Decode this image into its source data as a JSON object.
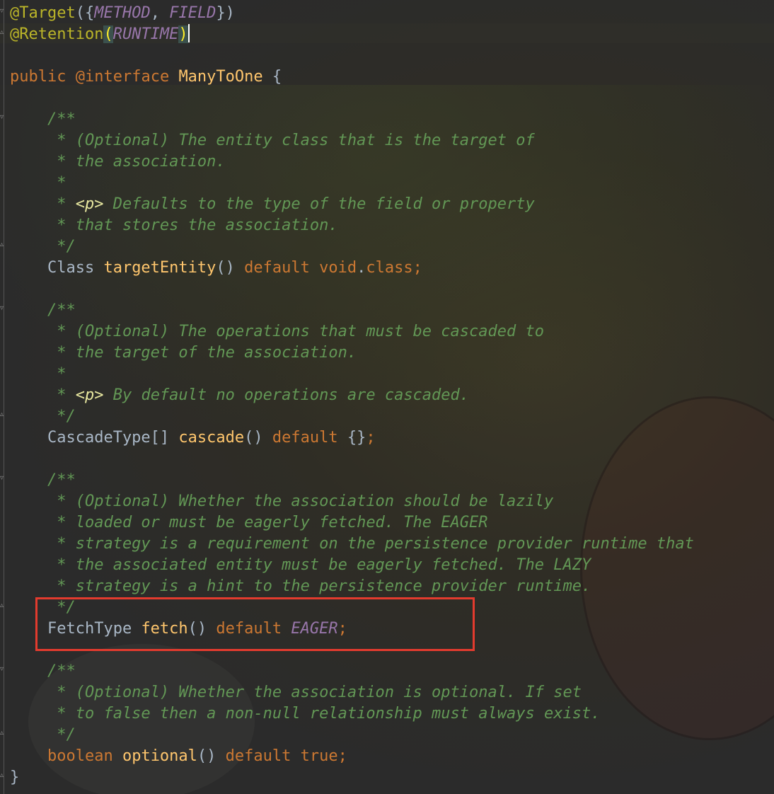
{
  "code_lines": [
    {
      "tokens": [
        {
          "t": "@Target",
          "c": "ann"
        },
        {
          "t": "({"
        },
        {
          "t": "METHOD",
          "c": "const"
        },
        {
          "t": ", "
        },
        {
          "t": "FIELD",
          "c": "const"
        },
        {
          "t": "})"
        }
      ]
    },
    {
      "tokens": [
        {
          "t": "@Retention",
          "c": "ann"
        },
        {
          "t": "(",
          "c": "brace-match"
        },
        {
          "t": "RUNTIME",
          "c": "const"
        },
        {
          "t": ")",
          "c": "brace-match"
        },
        {
          "t": "",
          "c": "caret"
        }
      ]
    },
    {
      "tokens": []
    },
    {
      "tokens": [
        {
          "t": "public",
          "c": "kw"
        },
        {
          "t": " "
        },
        {
          "t": "@interface",
          "c": "kw"
        },
        {
          "t": " "
        },
        {
          "t": "ManyToOne",
          "c": "fn"
        },
        {
          "t": " {"
        }
      ]
    },
    {
      "tokens": []
    },
    {
      "tokens": [
        {
          "t": "    /**",
          "c": "cmt"
        }
      ]
    },
    {
      "tokens": [
        {
          "t": "     * (Optional) The entity class that is the target of",
          "c": "cmt"
        }
      ]
    },
    {
      "tokens": [
        {
          "t": "     * the association.",
          "c": "cmt"
        }
      ]
    },
    {
      "tokens": [
        {
          "t": "     *",
          "c": "cmt"
        }
      ]
    },
    {
      "tokens": [
        {
          "t": "     * ",
          "c": "cmt"
        },
        {
          "t": "<p>",
          "c": "tag"
        },
        {
          "t": " Defaults to the type of the field or property",
          "c": "cmt"
        }
      ]
    },
    {
      "tokens": [
        {
          "t": "     * that stores the association.",
          "c": "cmt"
        }
      ]
    },
    {
      "tokens": [
        {
          "t": "     */",
          "c": "cmt"
        }
      ]
    },
    {
      "tokens": [
        {
          "t": "    Class "
        },
        {
          "t": "targetEntity",
          "c": "fn"
        },
        {
          "t": "() "
        },
        {
          "t": "default",
          "c": "kw"
        },
        {
          "t": " "
        },
        {
          "t": "void",
          "c": "kw"
        },
        {
          "t": "."
        },
        {
          "t": "class",
          "c": "kw"
        },
        {
          "t": ";",
          "c": "kw"
        }
      ]
    },
    {
      "tokens": []
    },
    {
      "tokens": [
        {
          "t": "    /**",
          "c": "cmt"
        }
      ]
    },
    {
      "tokens": [
        {
          "t": "     * (Optional) The operations that must be cascaded to",
          "c": "cmt"
        }
      ]
    },
    {
      "tokens": [
        {
          "t": "     * the target of the association.",
          "c": "cmt"
        }
      ]
    },
    {
      "tokens": [
        {
          "t": "     *",
          "c": "cmt"
        }
      ]
    },
    {
      "tokens": [
        {
          "t": "     * ",
          "c": "cmt"
        },
        {
          "t": "<p>",
          "c": "tag"
        },
        {
          "t": " By default no operations are cascaded.",
          "c": "cmt"
        }
      ]
    },
    {
      "tokens": [
        {
          "t": "     */",
          "c": "cmt"
        }
      ]
    },
    {
      "tokens": [
        {
          "t": "    CascadeType[] "
        },
        {
          "t": "cascade",
          "c": "fn"
        },
        {
          "t": "() "
        },
        {
          "t": "default",
          "c": "kw"
        },
        {
          "t": " {}"
        },
        {
          "t": ";",
          "c": "kw"
        }
      ]
    },
    {
      "tokens": []
    },
    {
      "tokens": [
        {
          "t": "    /**",
          "c": "cmt"
        }
      ]
    },
    {
      "tokens": [
        {
          "t": "     * (Optional) Whether the association should be lazily",
          "c": "cmt"
        }
      ]
    },
    {
      "tokens": [
        {
          "t": "     * loaded or must be eagerly fetched. The EAGER",
          "c": "cmt"
        }
      ]
    },
    {
      "tokens": [
        {
          "t": "     * strategy is a requirement on the persistence provider runtime that",
          "c": "cmt"
        }
      ]
    },
    {
      "tokens": [
        {
          "t": "     * the associated entity must be eagerly fetched. The LAZY",
          "c": "cmt"
        }
      ]
    },
    {
      "tokens": [
        {
          "t": "     * strategy is a hint to the persistence provider runtime.",
          "c": "cmt"
        }
      ]
    },
    {
      "tokens": [
        {
          "t": "     */",
          "c": "cmt"
        }
      ]
    },
    {
      "tokens": [
        {
          "t": "    FetchType "
        },
        {
          "t": "fetch",
          "c": "fn"
        },
        {
          "t": "() "
        },
        {
          "t": "default",
          "c": "kw"
        },
        {
          "t": " "
        },
        {
          "t": "EAGER",
          "c": "const"
        },
        {
          "t": ";",
          "c": "kw"
        }
      ]
    },
    {
      "tokens": []
    },
    {
      "tokens": [
        {
          "t": "    /**",
          "c": "cmt"
        }
      ]
    },
    {
      "tokens": [
        {
          "t": "     * (Optional) Whether the association is optional. If set",
          "c": "cmt"
        }
      ]
    },
    {
      "tokens": [
        {
          "t": "     * to false then a non-null relationship must always exist.",
          "c": "cmt"
        }
      ]
    },
    {
      "tokens": [
        {
          "t": "     */",
          "c": "cmt"
        }
      ]
    },
    {
      "tokens": [
        {
          "t": "    "
        },
        {
          "t": "boolean",
          "c": "kw"
        },
        {
          "t": " "
        },
        {
          "t": "optional",
          "c": "fn"
        },
        {
          "t": "() "
        },
        {
          "t": "default",
          "c": "kw"
        },
        {
          "t": " "
        },
        {
          "t": "true",
          "c": "kw"
        },
        {
          "t": ";",
          "c": "kw"
        }
      ]
    },
    {
      "tokens": [
        {
          "t": "}"
        }
      ]
    }
  ],
  "highlight": {
    "color": "#e33b2e"
  },
  "theme": {
    "annotation": "#bbb529",
    "keyword": "#cc7832",
    "constant": "#9876aa",
    "method": "#ffc66d",
    "comment": "#629755",
    "text": "#a9b7c6"
  }
}
